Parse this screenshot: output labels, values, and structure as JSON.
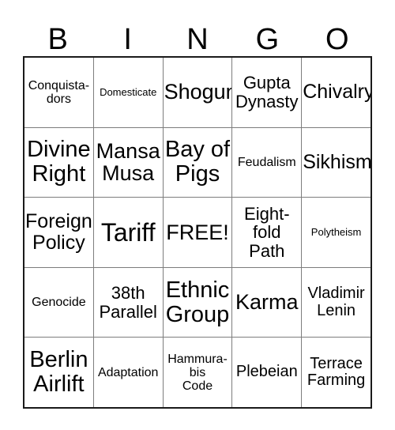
{
  "card": {
    "title": "BINGO",
    "header_letters": [
      "B",
      "I",
      "N",
      "G",
      "O"
    ],
    "free_space_label": "FREE!",
    "colors": {
      "outer_border": "#1a1a1a",
      "inner_border": "#7d7d7d",
      "cell_background": "#ffffff",
      "text": "#000000"
    },
    "rows": [
      {
        "cells": [
          {
            "text": "Conquista-\ndors",
            "size": "fs-sm"
          },
          {
            "text": "Domesticate",
            "size": "fs-xs"
          },
          {
            "text": "Shogun",
            "size": "fs-2xl"
          },
          {
            "text": "Gupta\nDynasty",
            "size": "fs-lg"
          },
          {
            "text": "Chivalry",
            "size": "fs-xl"
          }
        ]
      },
      {
        "cells": [
          {
            "text": "Divine\nRight",
            "size": "fs-3xl"
          },
          {
            "text": "Mansa\nMusa",
            "size": "fs-2xl"
          },
          {
            "text": "Bay of\nPigs",
            "size": "fs-3xl"
          },
          {
            "text": "Feudalism",
            "size": "fs-sm"
          },
          {
            "text": "Sikhism",
            "size": "fs-xl"
          }
        ]
      },
      {
        "cells": [
          {
            "text": "Foreign\nPolicy",
            "size": "fs-xl"
          },
          {
            "text": "Tariff",
            "size": "fs-4xl"
          },
          {
            "text": "FREE!",
            "size": "fs-2xl"
          },
          {
            "text": "Eight-\nfold\nPath",
            "size": "fs-lg"
          },
          {
            "text": "Polytheism",
            "size": "fs-xs"
          }
        ]
      },
      {
        "cells": [
          {
            "text": "Genocide",
            "size": "fs-sm"
          },
          {
            "text": "38th\nParallel",
            "size": "fs-lg"
          },
          {
            "text": "Ethnic\nGroup",
            "size": "fs-3xl"
          },
          {
            "text": "Karma",
            "size": "fs-2xl"
          },
          {
            "text": "Vladimir\nLenin",
            "size": "fs-md"
          }
        ]
      },
      {
        "cells": [
          {
            "text": "Berlin\nAirlift",
            "size": "fs-3xl"
          },
          {
            "text": "Adaptation",
            "size": "fs-sm"
          },
          {
            "text": "Hammura-\nbis\nCode",
            "size": "fs-sm"
          },
          {
            "text": "Plebeian",
            "size": "fs-md"
          },
          {
            "text": "Terrace\nFarming",
            "size": "fs-md"
          }
        ]
      }
    ]
  }
}
